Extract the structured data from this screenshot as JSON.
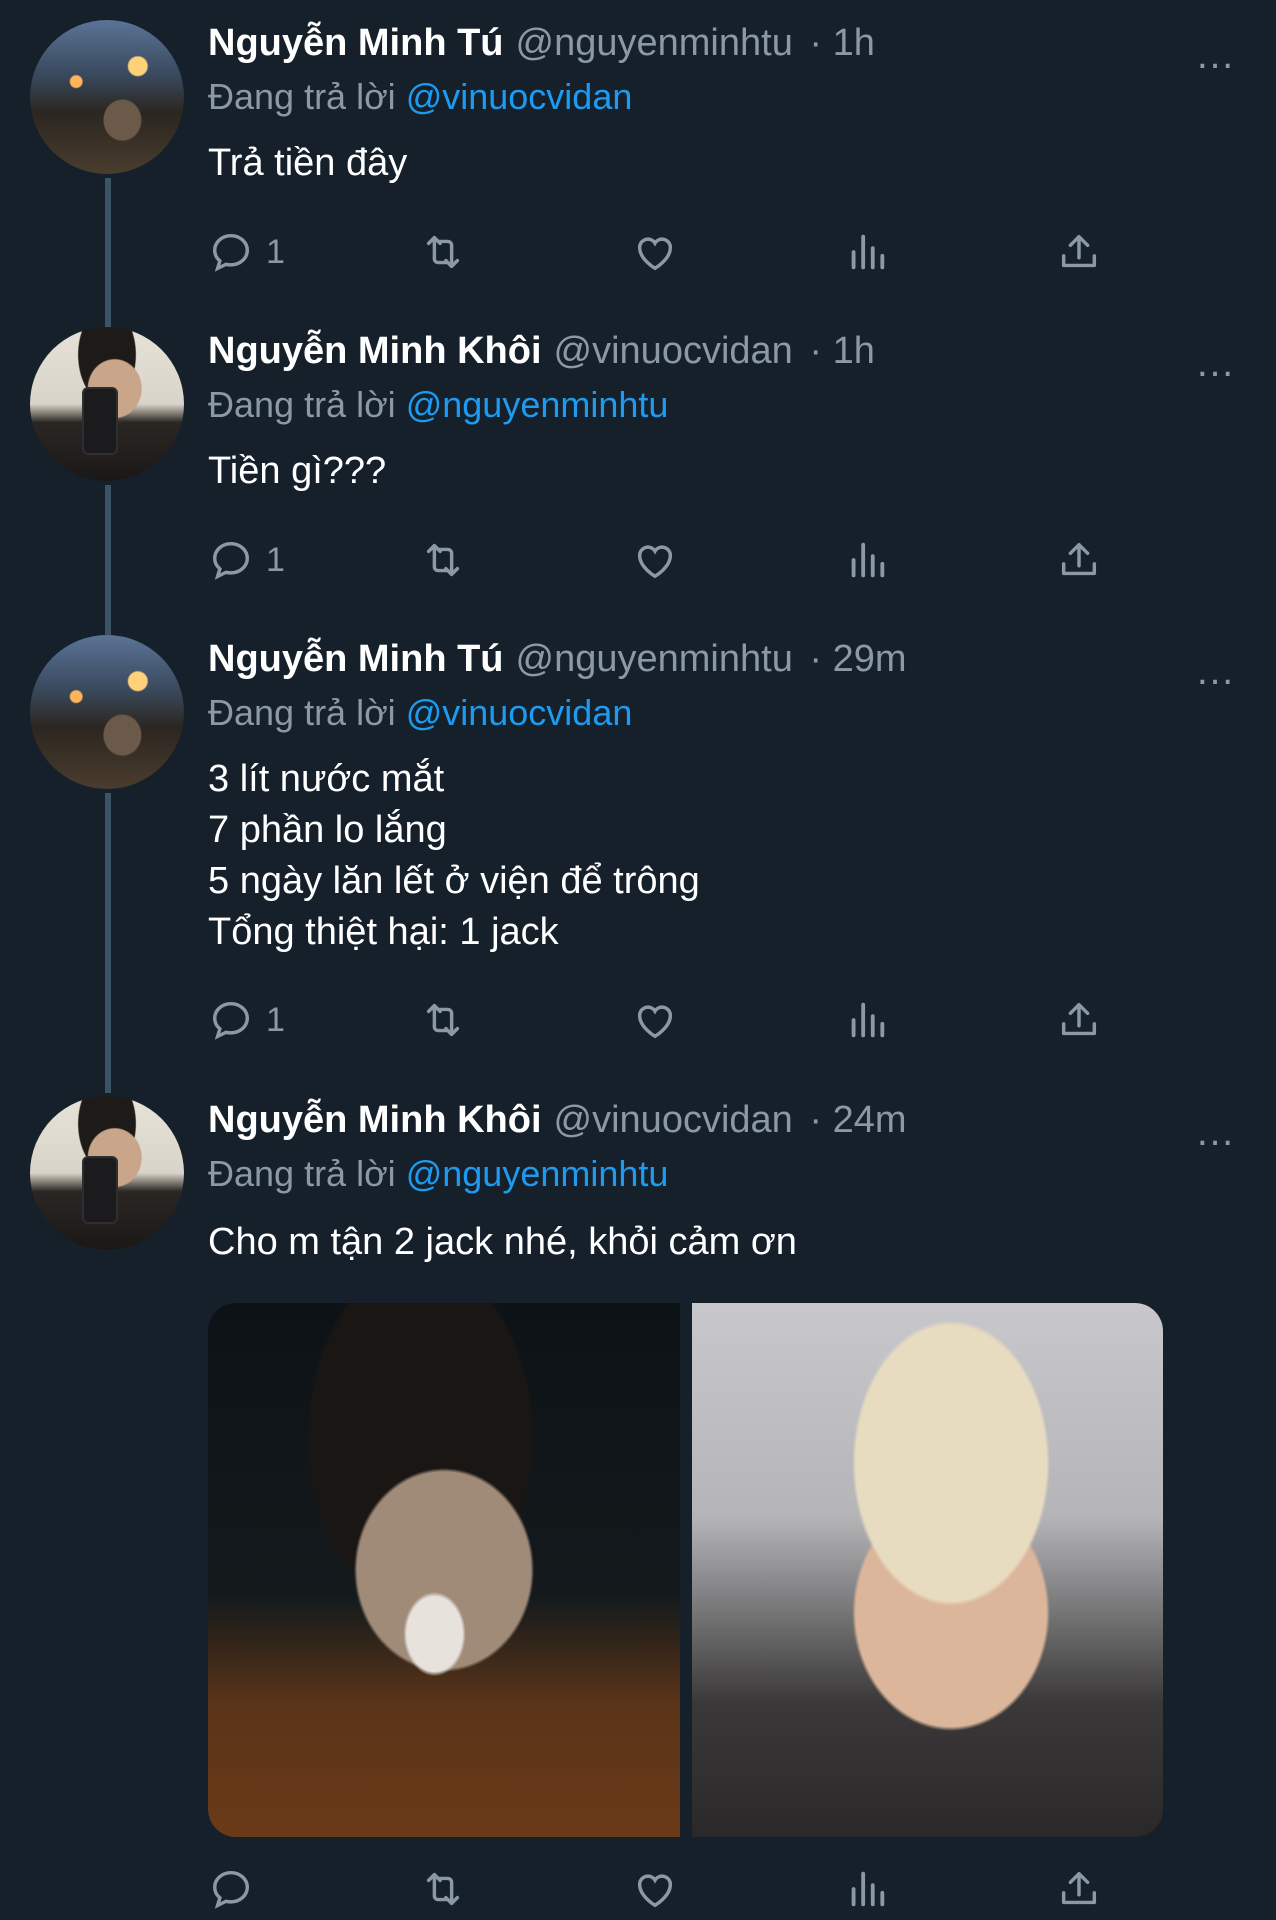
{
  "tweets": [
    {
      "name": "Nguyễn Minh Tú",
      "handle": "@nguyenminhtu",
      "time": "· 1h",
      "replying_prefix": "Đang trả lời",
      "replying_to": "@vinuocvidan",
      "text": "Trả tiền đây",
      "reply_count": "1"
    },
    {
      "name": "Nguyễn Minh Khôi",
      "handle": "@vinuocvidan",
      "time": "· 1h",
      "replying_prefix": "Đang trả lời",
      "replying_to": "@nguyenminhtu",
      "text": "Tiền gì???",
      "reply_count": "1"
    },
    {
      "name": "Nguyễn Minh Tú",
      "handle": "@nguyenminhtu",
      "time": "· 29m",
      "replying_prefix": "Đang trả lời",
      "replying_to": "@vinuocvidan",
      "text": "3 lít nước mắt\n7 phần lo lắng\n5 ngày lăn lết ở viện để trông\nTổng thiệt hại: 1 jack",
      "reply_count": "1"
    },
    {
      "name": "Nguyễn Minh Khôi",
      "handle": "@vinuocvidan",
      "time": "· 24m",
      "replying_prefix": "Đang trả lời",
      "replying_to": "@nguyenminhtu",
      "text": "Cho m tận 2 jack nhé, khỏi cảm ơn",
      "reply_count": ""
    }
  ],
  "more_icon": "…"
}
